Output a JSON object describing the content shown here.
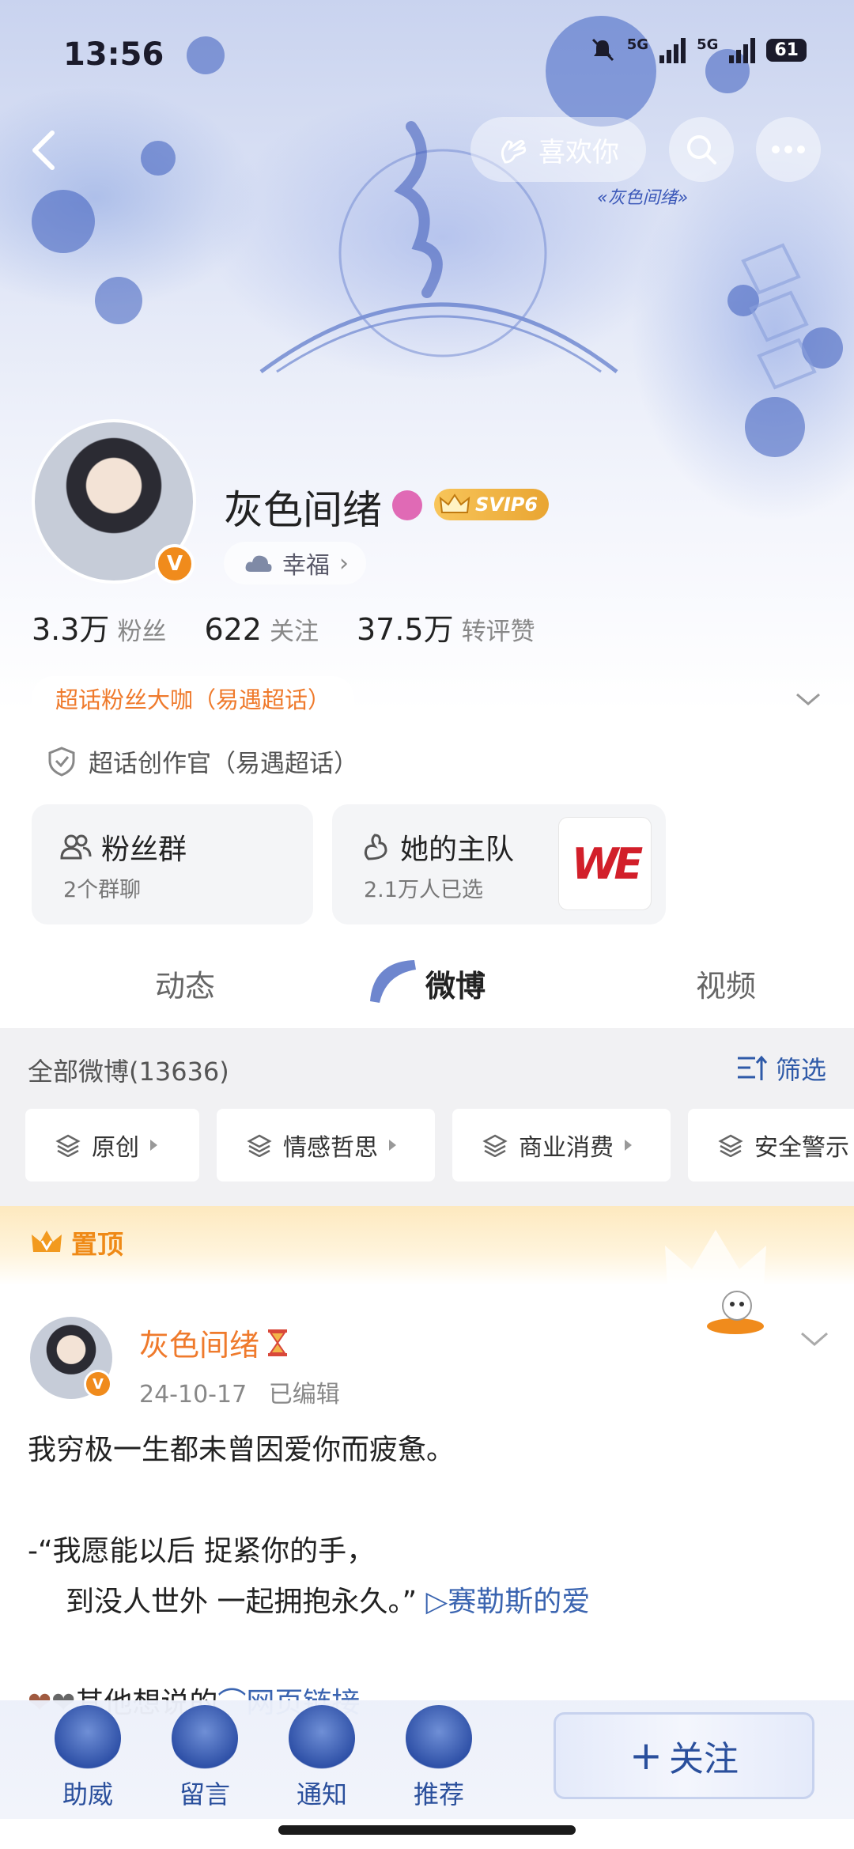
{
  "status_bar": {
    "time": "13:56",
    "net1": "5G",
    "net2": "5G",
    "battery": "61"
  },
  "header": {
    "like_label": "喜欢你"
  },
  "banner": {
    "caption": "«灰色间绪»"
  },
  "profile": {
    "name": "灰色间绪",
    "vip_label": "SVIP6",
    "mood": "幸福",
    "stats": [
      {
        "value": "3.3万",
        "label": "粉丝"
      },
      {
        "value": "622",
        "label": "关注"
      },
      {
        "value": "37.5万",
        "label": "转评赞"
      }
    ],
    "fan_tag": "超话粉丝大咖（易遇超话）",
    "creator_label": "超话创作官（易遇超话）"
  },
  "cards": {
    "fan_group": {
      "title": "粉丝群",
      "subtitle": "2个群聊"
    },
    "team": {
      "title": "她的主队",
      "subtitle": "2.1万人已选",
      "logo_text": "WE"
    }
  },
  "tabs": [
    {
      "label": "动态"
    },
    {
      "label": "微博"
    },
    {
      "label": "视频"
    }
  ],
  "feed": {
    "all_label": "全部微博(13636)",
    "filter_label": "筛选",
    "chips": [
      "原创",
      "情感哲思",
      "商业消费",
      "安全警示"
    ],
    "pinned_label": "置顶"
  },
  "post": {
    "author": "灰色间绪",
    "date": "24-10-17",
    "edited": "已编辑",
    "line1": "我穷极一生都未曾因爱你而疲惫。",
    "line2": "-“我愿能以后 捉紧你的手，",
    "line3": "到没人世外 一起拥抱永久。”",
    "link": "▷赛勒斯的爱",
    "line4_prefix": "其他想说的",
    "line4_link": "网页链接"
  },
  "bottom_bar": {
    "items": [
      "助威",
      "留言",
      "通知",
      "推荐"
    ],
    "follow_label": "关注"
  },
  "colors": {
    "accent": "#ef7a2c",
    "link": "#2f5aa8",
    "follow": "#2a4f9c"
  }
}
